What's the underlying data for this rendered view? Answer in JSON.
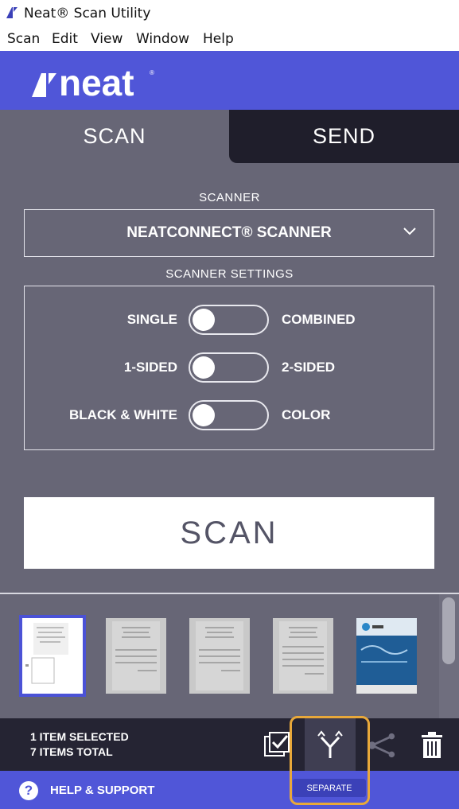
{
  "window": {
    "title": "Neat® Scan Utility"
  },
  "menu": [
    "Scan",
    "Edit",
    "View",
    "Window",
    "Help"
  ],
  "brand": {
    "logo_text": "neat"
  },
  "tabs": {
    "scan": "SCAN",
    "send": "SEND"
  },
  "scanner": {
    "label": "SCANNER",
    "selected": "NEATCONNECT® SCANNER"
  },
  "settings": {
    "label": "SCANNER SETTINGS",
    "options": [
      {
        "left": "SINGLE",
        "right": "COMBINED",
        "value": "left"
      },
      {
        "left": "1-SIDED",
        "right": "2-SIDED",
        "value": "left"
      },
      {
        "left": "BLACK & WHITE",
        "right": "COLOR",
        "value": "left"
      }
    ]
  },
  "scan_button": "SCAN",
  "status": {
    "selected": "1 ITEM SELECTED",
    "total": "7 ITEMS TOTAL"
  },
  "toolbar": {
    "separate_tooltip": "SEPARATE"
  },
  "help": {
    "label": "HELP & SUPPORT",
    "icon": "?"
  },
  "colors": {
    "brand_blue": "#5056d8",
    "panel_gray": "#676676",
    "dark": "#1f1e2b",
    "highlight_orange": "#e8a83a"
  }
}
